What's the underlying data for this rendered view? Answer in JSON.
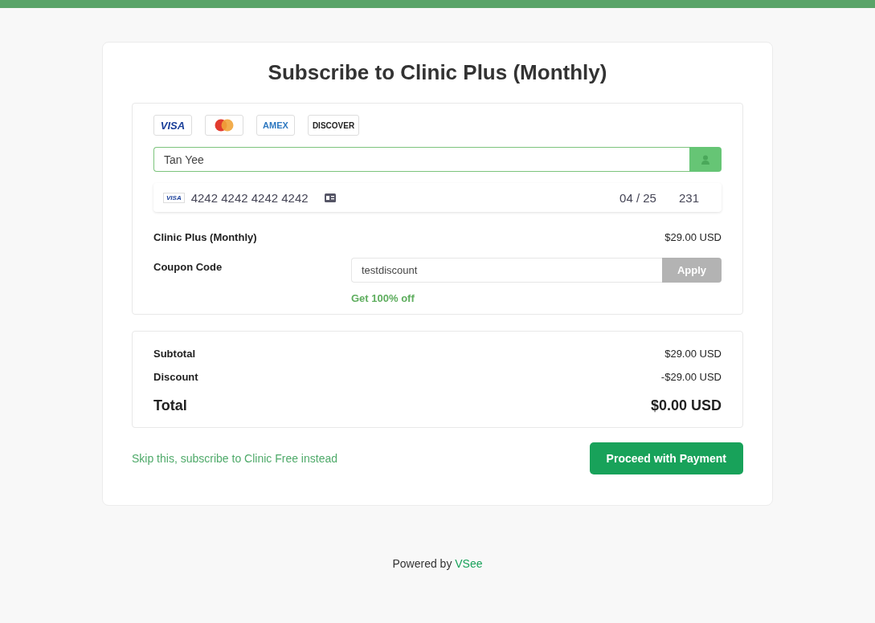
{
  "title": "Subscribe to Clinic Plus (Monthly)",
  "card_brands": [
    {
      "kind": "visa",
      "label": "VISA"
    },
    {
      "kind": "mastercard"
    },
    {
      "kind": "amex",
      "label": "AMEX"
    },
    {
      "kind": "discover",
      "label": "DISCOVER"
    }
  ],
  "name_field": {
    "value": "Tan Yee"
  },
  "card_field": {
    "brand_label": "VISA",
    "number": "4242 4242 4242 4242",
    "expiry": "04 / 25",
    "cvc": "231"
  },
  "plan": {
    "name": "Clinic Plus (Monthly)",
    "price": "$29.00 USD"
  },
  "coupon": {
    "label": "Coupon Code",
    "value": "testdiscount",
    "button": "Apply",
    "disabled": true,
    "message": "Get 100% off"
  },
  "summary": [
    {
      "kind": "line",
      "label": "Subtotal",
      "amount": "$29.00 USD"
    },
    {
      "kind": "line",
      "label": "Discount",
      "amount": "-$29.00 USD"
    },
    {
      "kind": "total",
      "label": "Total",
      "amount": "$0.00 USD"
    }
  ],
  "skip_link": "Skip this, subscribe to Clinic Free instead",
  "proceed_button": "Proceed with Payment",
  "footer": {
    "text": "Powered by",
    "link": "VSee"
  }
}
